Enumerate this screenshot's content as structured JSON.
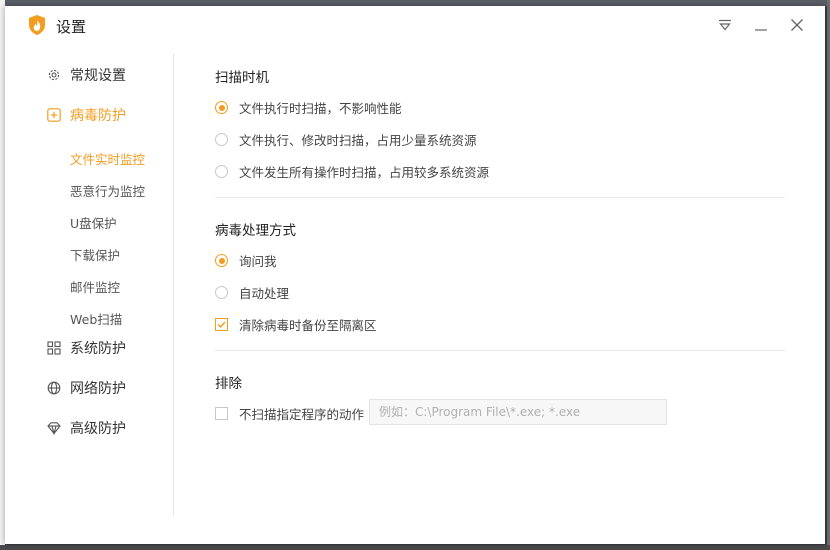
{
  "window": {
    "title": "设置"
  },
  "icons": {
    "logo": "flame-shield-icon",
    "menu": "dropdown-menu-icon",
    "minimize": "minimize-icon",
    "close": "close-icon"
  },
  "colors": {
    "accent": "#f39c1f"
  },
  "sidebar": {
    "general": "常规设置",
    "virus": "病毒防护",
    "virus_sub": [
      "文件实时监控",
      "恶意行为监控",
      "U盘保护",
      "下载保护",
      "邮件监控",
      "Web扫描"
    ],
    "system": "系统防护",
    "network": "网络防护",
    "advanced": "高级防护"
  },
  "scan_timing": {
    "title": "扫描时机",
    "options": [
      "文件执行时扫描，不影响性能",
      "文件执行、修改时扫描，占用少量系统资源",
      "文件发生所有操作时扫描，占用较多系统资源"
    ],
    "selected": 0
  },
  "virus_handling": {
    "title": "病毒处理方式",
    "options": [
      "询问我",
      "自动处理"
    ],
    "selected": 0,
    "backup_label": "清除病毒时备份至隔离区",
    "backup_checked": true
  },
  "exclude": {
    "title": "排除",
    "checkbox_label": "不扫描指定程序的动作",
    "checkbox_checked": false,
    "placeholder": "例如：C:\\Program File\\*.exe; *.exe"
  }
}
